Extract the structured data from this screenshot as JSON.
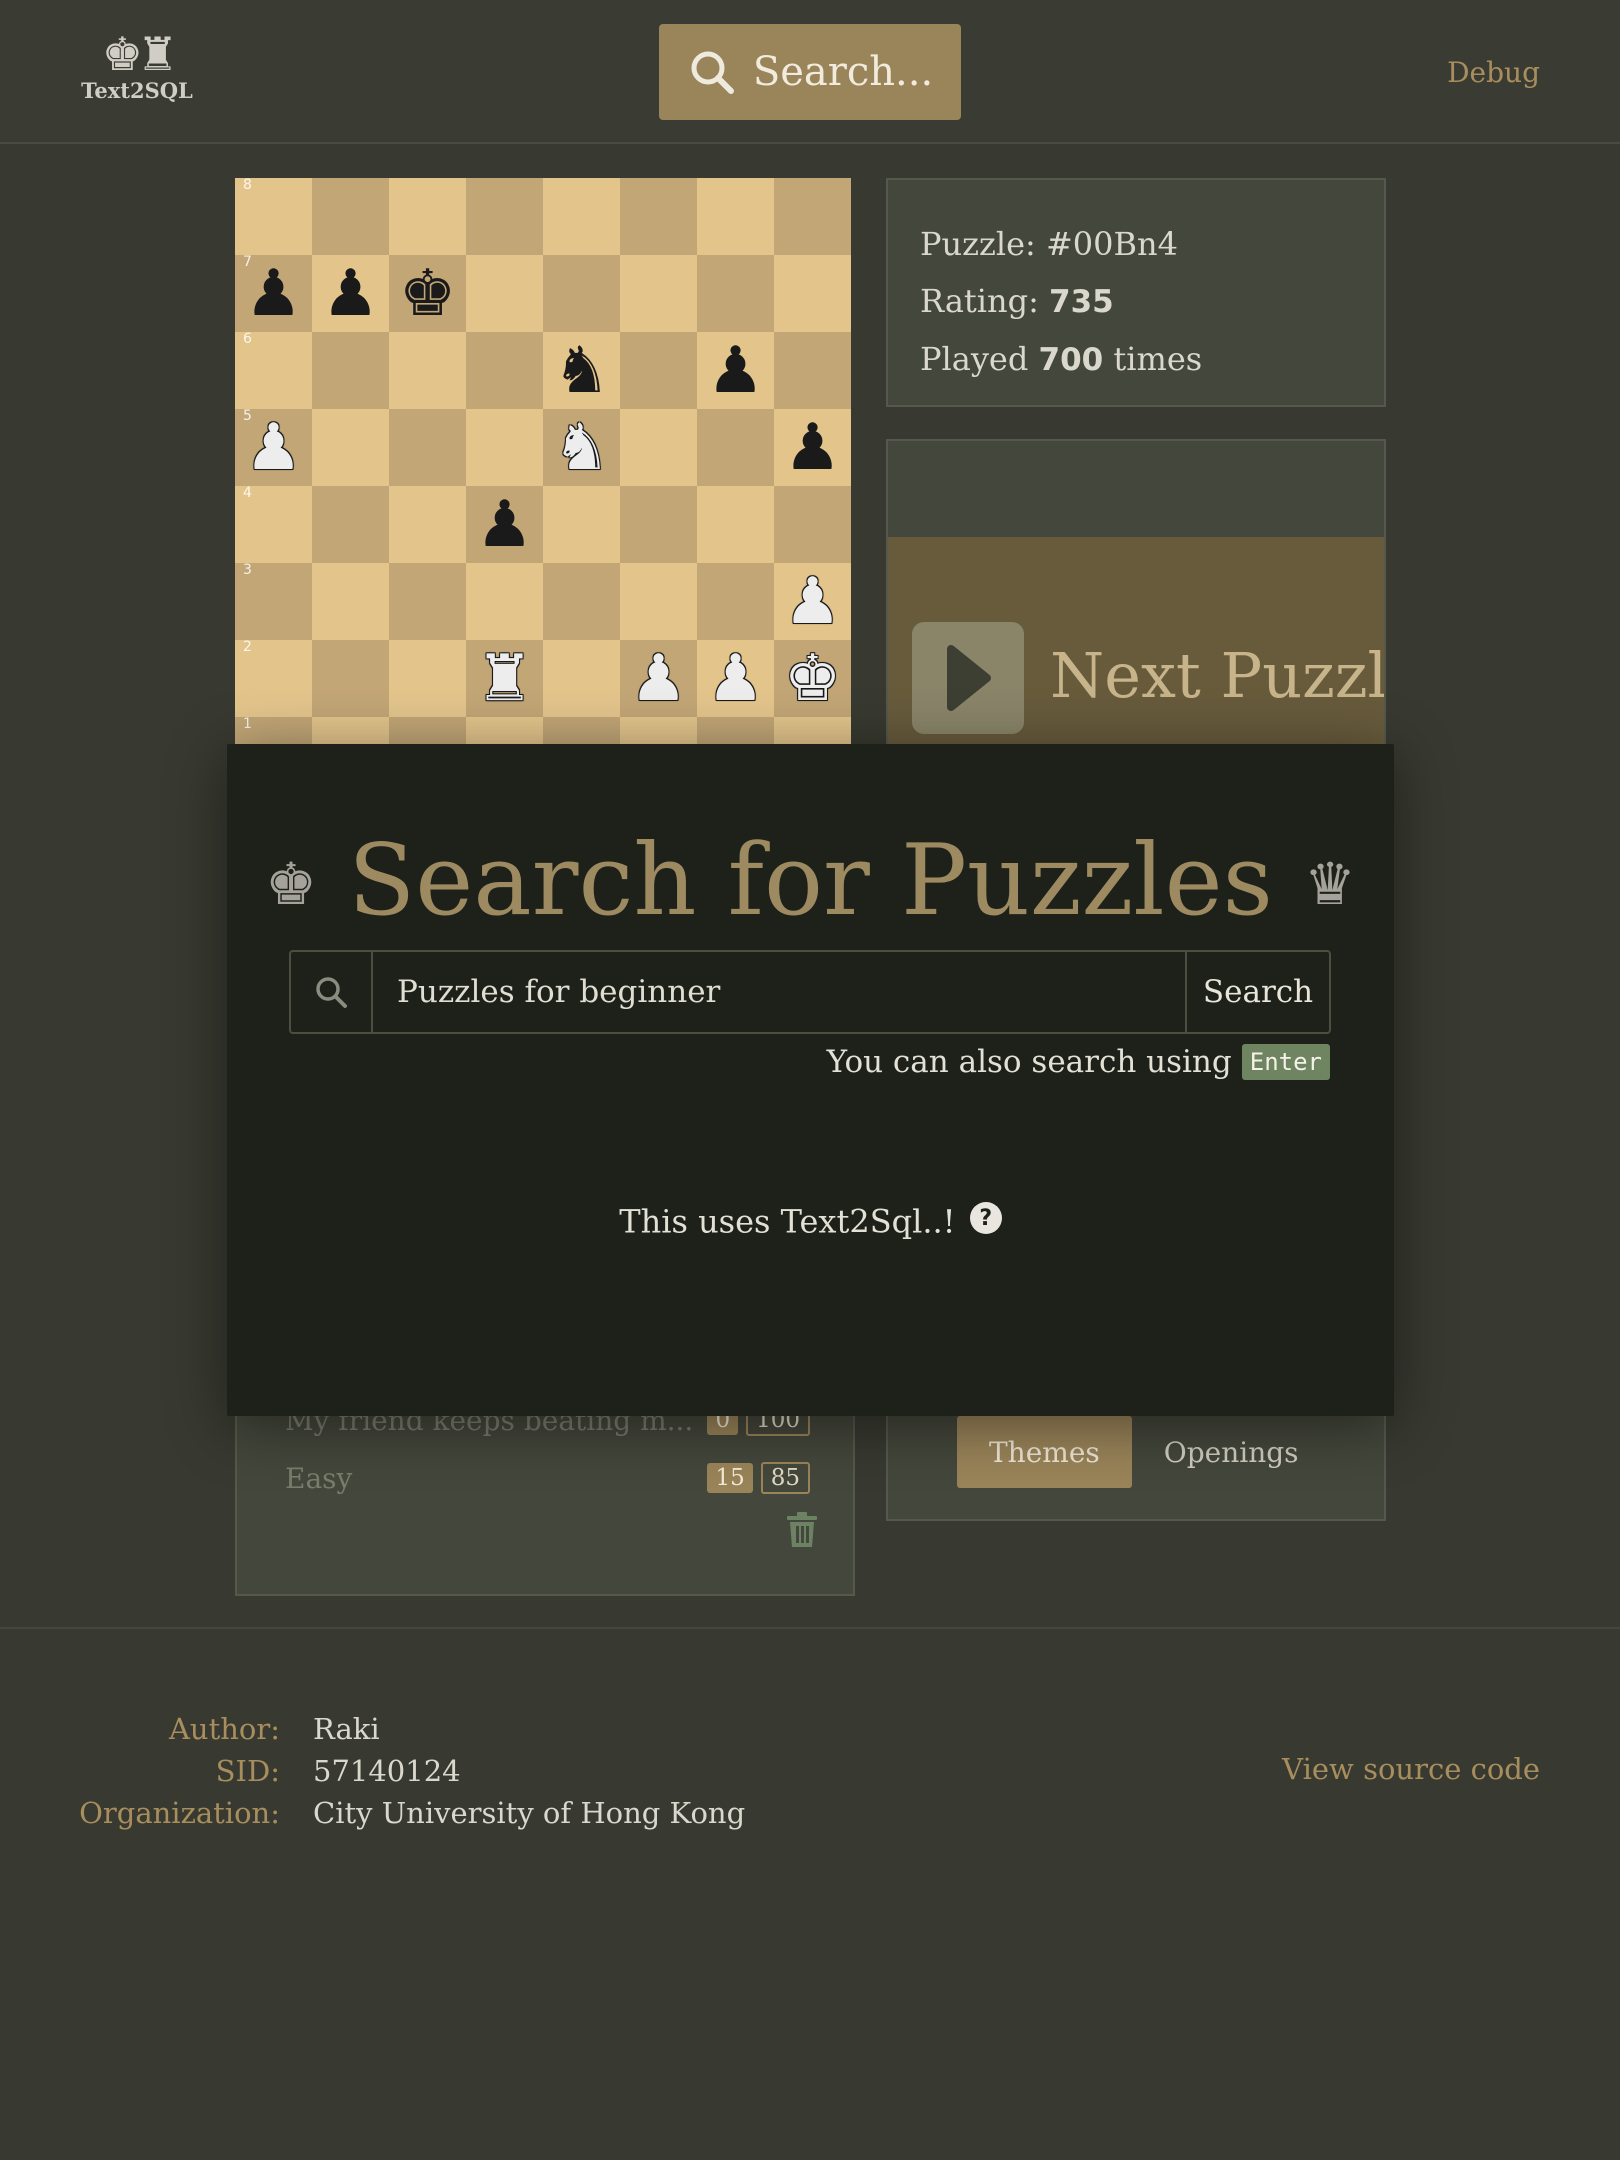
{
  "header": {
    "logo_pieces": "♚♜",
    "logo_text": "Text2SQL",
    "search_label": "Search...",
    "debug_label": "Debug"
  },
  "board": {
    "ranks": [
      "8",
      "7",
      "6",
      "5",
      "4",
      "3",
      "2",
      "1"
    ],
    "position": [
      [
        "",
        "",
        "",
        "",
        "",
        "",
        "",
        ""
      ],
      [
        "bp",
        "bp",
        "bk",
        "",
        "",
        "",
        "",
        ""
      ],
      [
        "",
        "",
        "",
        "",
        "bn",
        "",
        "bp",
        ""
      ],
      [
        "wp",
        "",
        "",
        "",
        "wn",
        "",
        "",
        "bp"
      ],
      [
        "",
        "",
        "",
        "bp",
        "",
        "",
        "",
        ""
      ],
      [
        "",
        "",
        "",
        "",
        "",
        "",
        "",
        "wp"
      ],
      [
        "",
        "",
        "",
        "wr",
        "",
        "wp",
        "wp",
        "wk"
      ],
      [
        "",
        "",
        "",
        "",
        "",
        "",
        "",
        ""
      ]
    ]
  },
  "puzzle_info": {
    "puzzle_label": "Puzzle:",
    "puzzle_id": "#00Bn4",
    "rating_label": "Rating:",
    "rating": "735",
    "played_prefix": "Played",
    "played_count": "700",
    "played_suffix": "times"
  },
  "next_puzzle": {
    "label": "Next Puzzle"
  },
  "tabs": [
    {
      "label": "Themes",
      "active": true
    },
    {
      "label": "Openings",
      "active": false
    }
  ],
  "history": {
    "items": [
      {
        "name": "My friend keeps beating m...",
        "a": "0",
        "b": "100"
      },
      {
        "name": "Easy",
        "a": "15",
        "b": "85"
      }
    ]
  },
  "modal": {
    "title": "Search for Puzzles",
    "crown_left": "♚",
    "crown_right": "♛",
    "search_value": "Puzzles for beginner",
    "search_button": "Search",
    "hint_text": "You can also search using",
    "hint_key": "Enter",
    "uses_text": "This uses Text2Sql..!",
    "help_symbol": "?"
  },
  "footer": {
    "author_label": "Author:",
    "author": "Raki",
    "sid_label": "SID:",
    "sid": "57140124",
    "org_label": "Organization:",
    "org": "City University of Hong Kong",
    "source_link": "View source code"
  },
  "colors": {
    "accent": "#9a8459",
    "background": "#383a31",
    "modal": "#1d211a",
    "board_light": "#e3c58c",
    "board_dark": "#c2a676"
  }
}
